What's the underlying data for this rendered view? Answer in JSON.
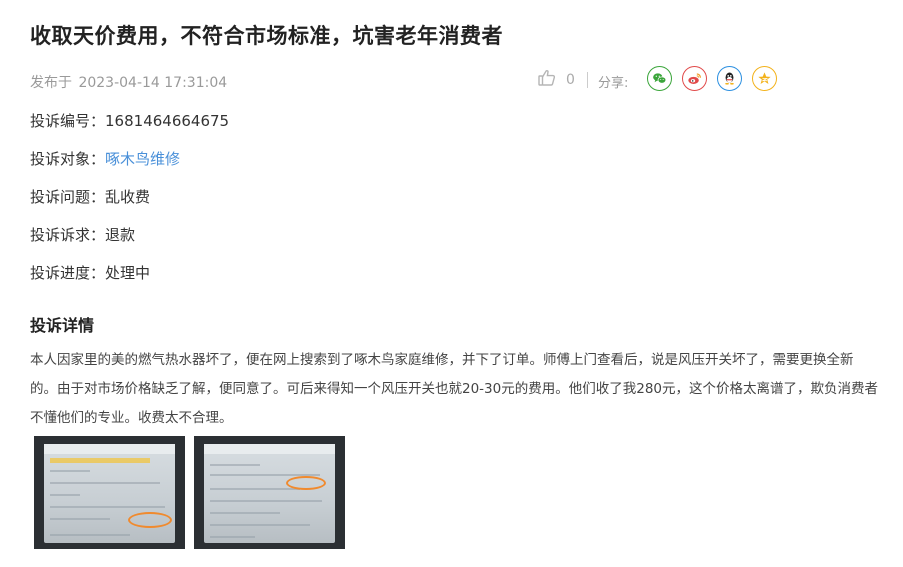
{
  "title": "收取天价费用，不符合市场标准，坑害老年消费者",
  "meta": {
    "published_label": "发布于",
    "published_time": "2023-04-14 17:31:04",
    "like_count": "0",
    "share_label": "分享:"
  },
  "share_icons": [
    "wechat-icon",
    "weibo-icon",
    "qq-icon",
    "qzone-icon"
  ],
  "info": [
    {
      "key": "投诉编号：",
      "value": "1681464664675"
    },
    {
      "key": "投诉对象：",
      "value": "啄木鸟维修"
    },
    {
      "key": "投诉问题：",
      "value": "乱收费"
    },
    {
      "key": "投诉诉求：",
      "value": "退款"
    },
    {
      "key": "投诉进度：",
      "value": "处理中"
    }
  ],
  "section_title": "投诉详情",
  "detail_text": "本人因家里的美的燃气热水器坏了，便在网上搜索到了啄木鸟家庭维修，并下了订单。师傅上门查看后，说是风压开关坏了，需要更换全新的。由于对市场价格缺乏了解，便同意了。可后来得知一个风压开关也就20-30元的费用。他们收了我280元，这个价格太离谱了，欺负消费者不懂他们的专业。收费太不合理。",
  "colors": {
    "link": "#4a90d9",
    "wechat": "#3aa53a",
    "weibo": "#e14a4a",
    "qq": "#2b8fe0",
    "qzone": "#f3b21b"
  }
}
